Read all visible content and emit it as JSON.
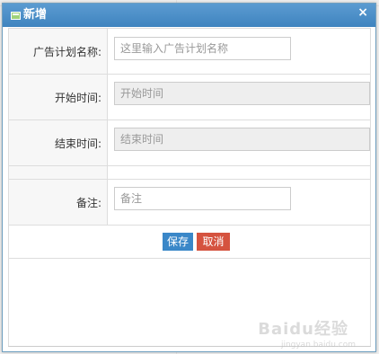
{
  "dialog": {
    "title": "新增",
    "close_glyph": "×",
    "title_icon": "form-window-icon",
    "close_icon": "close-icon"
  },
  "form": {
    "fields": [
      {
        "label": "广告计划名称:",
        "placeholder": "这里输入广告计划名称",
        "value": ""
      },
      {
        "label": "开始时间:",
        "placeholder": "开始时间",
        "value": ""
      },
      {
        "label": "结束时间:",
        "placeholder": "结束时间",
        "value": ""
      },
      {
        "label": "备注:",
        "placeholder": "备注",
        "value": ""
      }
    ]
  },
  "actions": {
    "save_label": "保存",
    "cancel_label": "取消"
  },
  "watermark": {
    "text": "Baidu经验",
    "sub": "jingyan.baidu.com"
  },
  "colors": {
    "titlebar": "#4a8fc8",
    "save_button": "#3a87c8",
    "cancel_button": "#d5533f",
    "label_background": "#f7f7f7",
    "readonly_input": "#eeeeee"
  }
}
